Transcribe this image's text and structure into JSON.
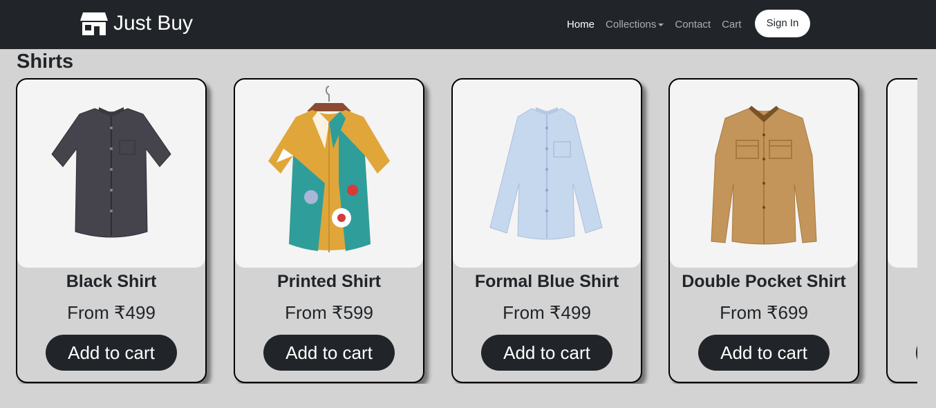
{
  "navbar": {
    "brand": "Just Buy",
    "brand_icon": "store-icon",
    "links": [
      "Home",
      "Collections",
      "Contact",
      "Cart"
    ],
    "active": "Home",
    "sign_in": "Sign In"
  },
  "section": {
    "title": "Shirts",
    "products": [
      {
        "name": "Black Shirt",
        "price": "From ₹499",
        "button": "Add to cart",
        "color": "#45444d"
      },
      {
        "name": "Printed Shirt",
        "price": "From ₹599",
        "button": "Add to cart",
        "color": "#e0a63a"
      },
      {
        "name": "Formal Blue Shirt",
        "price": "From ₹499",
        "button": "Add to cart",
        "color": "#c6d8ee"
      },
      {
        "name": "Double Pocket Shirt",
        "price": "From ₹699",
        "button": "Add to cart",
        "color": "#c4955a"
      }
    ]
  }
}
